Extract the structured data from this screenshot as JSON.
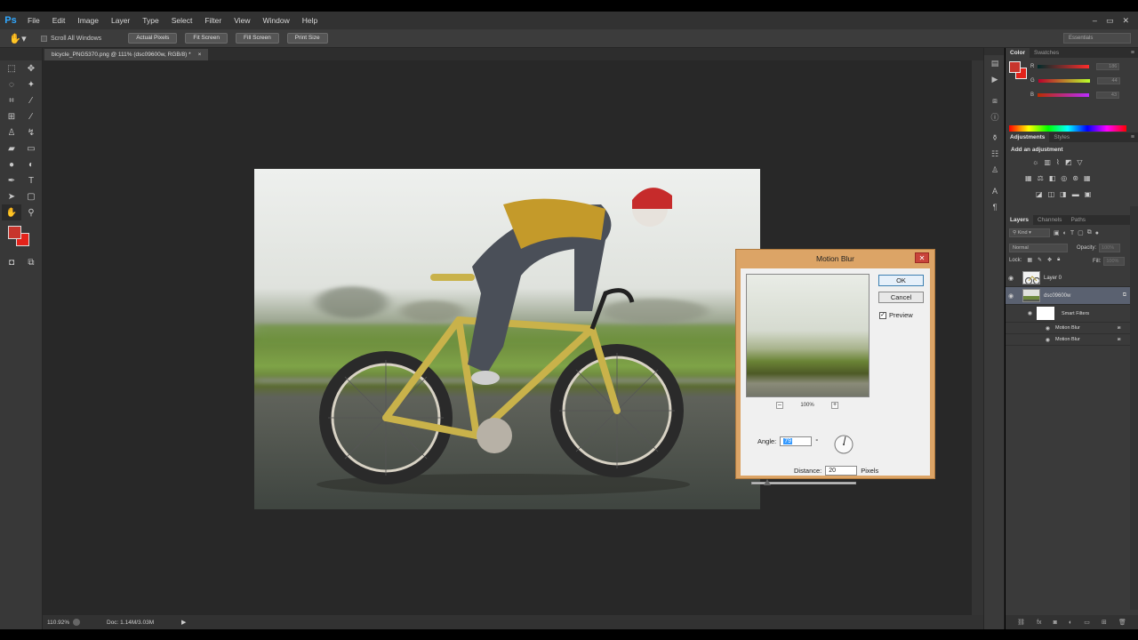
{
  "app": {
    "logo": "Ps",
    "menu": [
      "File",
      "Edit",
      "Image",
      "Layer",
      "Type",
      "Select",
      "Filter",
      "View",
      "Window",
      "Help"
    ],
    "window_controls": [
      "–",
      "▭",
      "✕"
    ]
  },
  "options_bar": {
    "scroll_all_windows": "Scroll All Windows",
    "buttons": [
      "Actual Pixels",
      "Fit Screen",
      "Fill Screen",
      "Print Size"
    ],
    "workspace": "Essentials"
  },
  "document": {
    "tab_title": "bicycle_PNG5370.png @ 111% (dsc09600w, RGB/8) *",
    "tab_close": "×",
    "zoom": "110.92%",
    "doc_size": "Doc: 1.14M/3.03M"
  },
  "dialog": {
    "title": "Motion Blur",
    "ok": "OK",
    "cancel": "Cancel",
    "preview_label": "Preview",
    "preview_checked": true,
    "preview_zoom": "100%",
    "angle_label": "Angle:",
    "angle_value": "79",
    "angle_unit": "°",
    "distance_label": "Distance:",
    "distance_value": "20",
    "distance_unit": "Pixels"
  },
  "color_panel": {
    "tabs": [
      "Color",
      "Swatches"
    ],
    "channels": [
      {
        "label": "R",
        "value": "186"
      },
      {
        "label": "G",
        "value": "44"
      },
      {
        "label": "B",
        "value": "43"
      }
    ],
    "foreground": "#c8352c",
    "background": "#e4231b"
  },
  "adjustments_panel": {
    "tabs": [
      "Adjustments",
      "Styles"
    ],
    "title": "Add an adjustment"
  },
  "layers_panel": {
    "tabs": [
      "Layers",
      "Channels",
      "Paths"
    ],
    "kind": "Kind",
    "blend_mode": "Normal",
    "opacity_label": "Opacity:",
    "opacity_value": "100%",
    "lock_label": "Lock:",
    "fill_label": "Fill:",
    "fill_value": "100%",
    "layers": [
      {
        "name": "Layer 0"
      },
      {
        "name": "dsc09600w"
      }
    ],
    "smart_filters": "Smart Filters",
    "filters": [
      "Motion Blur",
      "Motion Blur"
    ]
  }
}
